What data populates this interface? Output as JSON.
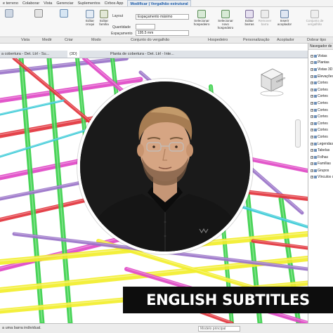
{
  "ribbon": {
    "tabs": [
      {
        "label": "e terreno",
        "active": false
      },
      {
        "label": "Colaborar",
        "active": false
      },
      {
        "label": "Vista",
        "active": false
      },
      {
        "label": "Gerenciar",
        "active": false
      },
      {
        "label": "Suplementos",
        "active": false
      },
      {
        "label": "Cirbos App",
        "active": false
      },
      {
        "label": "Modificar | Vergalhão estrutural",
        "active": true
      }
    ],
    "tools": {
      "editar_croqui": "Editar croqui",
      "editar_familia": "Editar família",
      "selecionar_hospedeiro": "Selecionar hospedeiro",
      "selecionar_novo_hospedeiro": "Selecionar novo hospedeiro",
      "editar_barras": "Editar barras",
      "remover_barra": "Remover barra",
      "inserir_acoplador": "Inserir acoplador",
      "conjunto_vergalhao": "Conjunto de vergalhão"
    },
    "fields": {
      "layout_label": "Layout",
      "layout_value": "Espaçamento máximo",
      "quantidade_label": "Quantidade",
      "espacamento_label": "Espaçamento",
      "espacamento_value": "195.5 mm"
    },
    "panels": {
      "vista": "Vista",
      "medir": "Medir",
      "criar": "Criar",
      "modo": "Modo",
      "conjunto": "Conjunto do vergalhão",
      "hospedeiro": "Hospedeiro",
      "personalizacao": "Personalização",
      "acoplador": "Acoplador",
      "dobrar_tipo": "Dobrar tipo"
    }
  },
  "view_tabs": [
    {
      "label": "a cobertura - Det. Ltrl - Su...",
      "active": false
    },
    {
      "label": "{3D}",
      "active": true
    },
    {
      "label": "Planta de cobertura - Det. Ltrl - Inte...",
      "active": false
    }
  ],
  "viewcube": {
    "face_label": "FRONTAL"
  },
  "browser": {
    "title": "Navegador de projeto",
    "items": [
      {
        "label": "Vistas",
        "expanded": true
      },
      {
        "label": "Plantas",
        "expanded": true
      },
      {
        "label": "Vistas 3D",
        "expanded": false
      },
      {
        "label": "Elevações",
        "expanded": false
      },
      {
        "label": "Cortes",
        "expanded": false
      },
      {
        "label": "Cortes",
        "expanded": false
      },
      {
        "label": "Cortes",
        "expanded": false
      },
      {
        "label": "Cortes",
        "expanded": false
      },
      {
        "label": "Cortes",
        "expanded": false
      },
      {
        "label": "Cortes",
        "expanded": false
      },
      {
        "label": "Cortes",
        "expanded": false
      },
      {
        "label": "Cortes",
        "expanded": false
      },
      {
        "label": "Cortes",
        "expanded": false
      },
      {
        "label": "Legendas",
        "expanded": false
      },
      {
        "label": "Tabelas",
        "expanded": false
      },
      {
        "label": "Folhas",
        "expanded": false
      },
      {
        "label": "Famílias",
        "expanded": false
      },
      {
        "label": "Grupos",
        "expanded": false
      },
      {
        "label": "Vínculos do Revit",
        "expanded": false
      }
    ]
  },
  "status": {
    "message": "a uma barra individual.",
    "model": "Modelo principal"
  },
  "caption": "ENGLISH SUBTITLES",
  "colors": {
    "rebar_green": "#3ad14a",
    "rebar_magenta": "#e048c6",
    "rebar_red": "#e2343c",
    "rebar_yellow": "#f2ee2c",
    "rebar_purple": "#9a73c8",
    "rebar_cyan": "#36c9d6",
    "caption_bg": "#0d0d0d"
  }
}
